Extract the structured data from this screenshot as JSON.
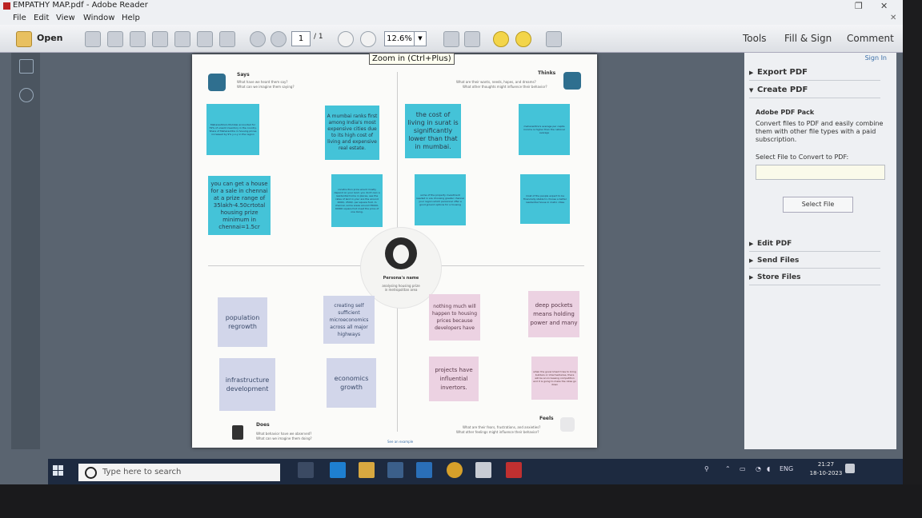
{
  "window": {
    "title": "EMPATHY MAP.pdf - Adobe Reader"
  },
  "menu": [
    "File",
    "Edit",
    "View",
    "Window",
    "Help"
  ],
  "toolbar": {
    "open_label": "Open",
    "page_current": "1",
    "page_total": "/ 1",
    "zoom": "12.6%",
    "tabs": [
      "Tools",
      "Fill & Sign",
      "Comment"
    ],
    "tooltip": "Zoom in (Ctrl+Plus)"
  },
  "map": {
    "says": {
      "title": "Says",
      "sub1": "What have we heard them say?",
      "sub2": "What can we imagine them saying?"
    },
    "thinks": {
      "title": "Thinks",
      "sub1": "What are their wants, needs, hopes, and dreams?",
      "sub2": "What other thoughts might influence their behavior?"
    },
    "does": {
      "title": "Does",
      "sub1": "What behavior have we observed?",
      "sub2": "What can we imagine them doing?"
    },
    "feels": {
      "title": "Feels",
      "sub1": "What are their fears, frustrations, and anxieties?",
      "sub2": "What other feelings might influence their behavior?"
    },
    "persona_name": "Persona's name",
    "persona_sub": "analysing housing prize in metropolitan area",
    "see_example": "See an example",
    "notes": {
      "n1": "Maharashtra's Mumbai accounted for 79% of unsold inventory in the country. Share of Maharashtra in housing prices increased by 9% y-o-y in the region",
      "n2": "A mumbai ranks first among India's most expensive cities due to its high cost of living and expensive real estate.",
      "n3": "the cost of living in surat is significantly lower than that in mumbai.",
      "n4": "maharashtra's average per capita income is higher than the national average",
      "n5": "you can get a house for a sale in chennai at a prize range of 35lakh-4.50crtotal housing prize minimum in chennai=1.5cr",
      "n6": "construction price would mostly depend on your land. you don't own a residential home in places, see the rates of land in your are the around 2000/- 2500/- per square foot. In chennai, some areas around 35000-40000 square foot meet the price of one living.",
      "n7": "some of the property investment needed in are choosing greater chennai your region which personnel offer a good ground options for a housing",
      "n8": "most of the people expect to be financially stable to choose a better residential house in metro cities",
      "n9": "population regrowth",
      "n10": "creating self sufficient microeconomics across all major highways",
      "n11": "nothing much will happen to housing prices because developers have",
      "n12": "deep pockets means holding power and many",
      "n13": "infrastructure development",
      "n14": "economics growth",
      "n15": "projects have influential invertors.",
      "n16": "when the government tries to bring builders or intermediaries, there will be an increasing competition and it is going to make the rates go down"
    }
  },
  "right_panel": {
    "sign_in": "Sign In",
    "export_pdf": "Export PDF",
    "create_pdf": "Create PDF",
    "pack_title": "Adobe PDF Pack",
    "pack_desc": "Convert files to PDF and easily combine them with other file types with a paid subscription.",
    "select_label": "Select File to Convert to PDF:",
    "select_button": "Select File",
    "edit_pdf": "Edit PDF",
    "send_files": "Send Files",
    "store_files": "Store Files"
  },
  "taskbar": {
    "search_placeholder": "Type here to search",
    "lang": "ENG",
    "time": "21:27",
    "date": "18-10-2023"
  },
  "colors": {
    "note_cyan": "#44c3d8",
    "note_lavender": "#d2d6ea",
    "note_pink": "#ecd2e2",
    "taskbar": "#1d2a40"
  }
}
